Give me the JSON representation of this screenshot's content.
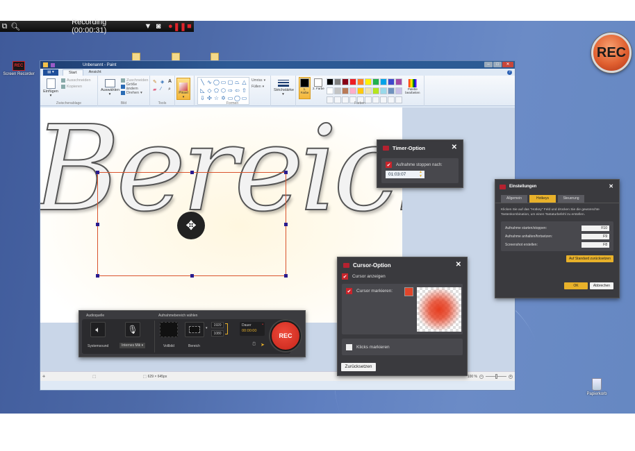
{
  "recording_toolbar": {
    "title": "Recording (00:00:31)",
    "icons": [
      "restore-window-icon",
      "zoom-icon",
      "dropdown-icon",
      "camera-icon",
      "record-icon",
      "pause-icon",
      "stop-icon"
    ]
  },
  "desktop": {
    "icons": [
      {
        "label": "Screen Recorder",
        "icon": "screen-recorder-icon"
      },
      {
        "label": "Papierkorb",
        "icon": "recycle-bin-icon"
      }
    ],
    "rec_badge": "REC"
  },
  "paint": {
    "window_title": "Unbenannt - Paint",
    "tabs": [
      "Start",
      "Ansicht"
    ],
    "active_tab": "Start",
    "groups": {
      "clipboard": {
        "label": "Zwischenablage",
        "paste": "Einfügen",
        "cut": "Ausschneiden",
        "copy": "Kopieren"
      },
      "image": {
        "label": "Bild",
        "select": "Auswählen",
        "crop": "Zuschneiden",
        "resize": "Größe ändern",
        "rotate": "Drehen"
      },
      "tools": {
        "label": "Tools"
      },
      "brush": {
        "label": "Pinsel"
      },
      "shapes": {
        "label": "Formen",
        "outline": "Umriss",
        "fill": "Füllen",
        "glyphs": [
          "╲",
          "∿",
          "◯",
          "▭",
          "▢",
          "⏢",
          "△",
          "◺",
          "◇",
          "⬠",
          "⬡",
          "⇨",
          "⇦",
          "⇧",
          "⇩",
          "✣",
          "☆",
          "✡",
          "▭",
          "◯",
          "▭"
        ]
      },
      "stroke": {
        "label": "Strichstärke"
      },
      "colors": {
        "label": "Farben",
        "color1": "1. Farbe",
        "color2": "2. Farbe",
        "edit_palette": "Palette bearbeiten",
        "color1_value": "#000000",
        "color2_value": "#ffffff",
        "palette": [
          "#000000",
          "#7f7f7f",
          "#880015",
          "#ed1c24",
          "#ff7f27",
          "#fff200",
          "#22b14c",
          "#00a2e8",
          "#3f48cc",
          "#a349a4",
          "#ffffff",
          "#c3c3c3",
          "#b97a57",
          "#ffaec9",
          "#ffc90e",
          "#efe4b0",
          "#b5e61d",
          "#99d9ea",
          "#7092be",
          "#c8bfe7"
        ]
      }
    },
    "canvas_text": "Bereich",
    "status": {
      "size": "629 × 645px",
      "zoom": "100 %",
      "zoom_level": 0.5
    }
  },
  "timer_dialog": {
    "title": "Timer-Option",
    "checkbox_label": "Aufnahme stoppen nach:",
    "checked": true,
    "time_value": "01:03:07"
  },
  "settings_dialog": {
    "title": "Einstellungen",
    "tabs": [
      "Allgemein",
      "Hotkeys",
      "Steuerung"
    ],
    "active_tab": "Hotkeys",
    "description": "Klicken Sie auf das \"Hotkey\" Feld und drücken Sie die gewünschte Tastenkombination, um einen Tastaturbefehl zu erstellen.",
    "hotkeys": [
      {
        "label": "Aufnahme starten/stoppen:",
        "key": "F10"
      },
      {
        "label": "Aufnahme anhalten/fortsetzen:",
        "key": "F9"
      },
      {
        "label": "Screenshot erstellen:",
        "key": "F8"
      }
    ],
    "reset_label": "Auf Standard zurücksetzen",
    "ok_label": "OK",
    "cancel_label": "Abbrechen"
  },
  "cursor_dialog": {
    "title": "Cursor-Option",
    "show_cursor": {
      "label": "Cursor anzeigen",
      "checked": true
    },
    "highlight_cursor": {
      "label": "Cursor markieren:",
      "checked": true,
      "color": "#e0452a"
    },
    "mark_clicks": {
      "label": "Klicks markieren",
      "checked": false
    },
    "reset_label": "Zurücksetzen"
  },
  "recorder_bar": {
    "audio_section": "Audioquelle",
    "area_section": "Aufnahmebereich wählen",
    "system_sound": "Systemsound",
    "mic": "Internes Mik",
    "fullscreen": "Vollbild",
    "region": "Bereich",
    "width": "1920",
    "height": "1080",
    "duration_label": "Dauer",
    "duration_value": "00:00:00",
    "rec_label": "REC"
  }
}
